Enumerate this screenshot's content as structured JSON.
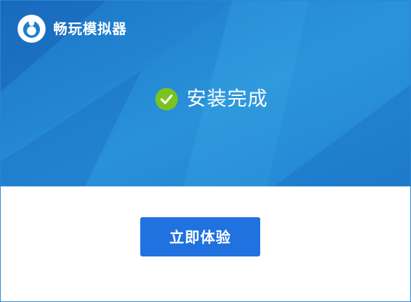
{
  "app": {
    "brand_name": "畅玩模拟器",
    "logo_icon": "cloud-play-logo-icon"
  },
  "status": {
    "icon": "check-circle-icon",
    "text": "安装完成",
    "icon_color": "#7ac31f"
  },
  "actions": {
    "start_label": "立即体验",
    "start_color": "#1f72df"
  },
  "theme": {
    "hero_color": "#1f7fce",
    "border_color": "#2b86d3"
  }
}
